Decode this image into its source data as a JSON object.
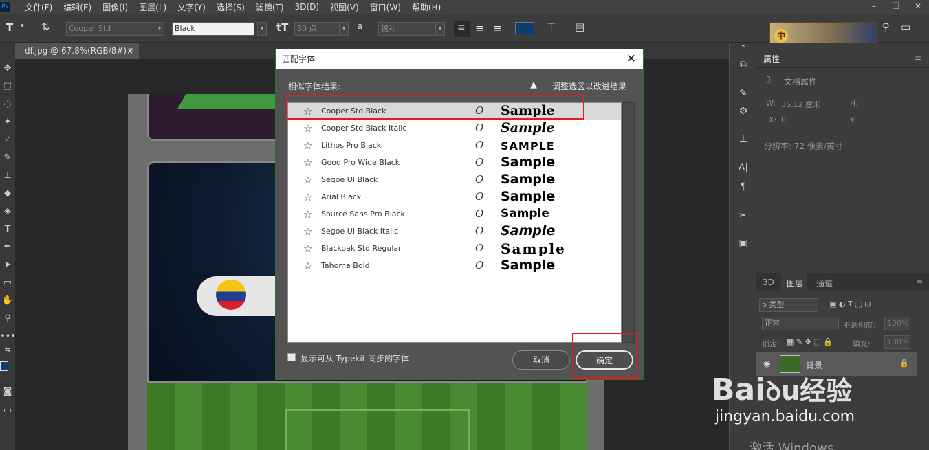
{
  "app": {
    "logo": "Ps"
  },
  "menubar": {
    "items": [
      "文件(F)",
      "编辑(E)",
      "图像(I)",
      "图层(L)",
      "文字(Y)",
      "选择(S)",
      "滤镜(T)",
      "3D(D)",
      "视图(V)",
      "窗口(W)",
      "帮助(H)"
    ]
  },
  "options": {
    "font_family": "Cooper Std",
    "font_style": "Black",
    "font_size": "30 点",
    "aa_label": "a",
    "antialias": "锐利"
  },
  "document": {
    "tab_title": "df.jpg @ 67.8%(RGB/8#) *",
    "tab_close": "×"
  },
  "ime": {
    "label": "中"
  },
  "properties": {
    "tab": "属性",
    "doc_props": "文档属性",
    "w_label": "W:",
    "w_value": "36.12 厘米",
    "h_label": "H:",
    "x_label": "X:",
    "x_value": "0",
    "y_label": "Y:",
    "resolution": "分辨率: 72 像素/英寸"
  },
  "layers": {
    "tabs": [
      "3D",
      "图层",
      "通道"
    ],
    "filter": "ρ 类型",
    "blend": "正常",
    "opacity_label": "不透明度:",
    "opacity": "100%",
    "lock_label": "锁定:",
    "fill_label": "填充:",
    "fill": "100%",
    "layer_name": "背景"
  },
  "dialog": {
    "title": "匹配字体",
    "close": "✕",
    "results_label": "相似字体结果:",
    "hint": "调整选区以改进结果",
    "fonts": [
      {
        "name": "Cooper Std Black",
        "type_glyph": "O",
        "sample": "Sample",
        "selected": true
      },
      {
        "name": "Cooper Std Black Italic",
        "type_glyph": "O",
        "sample": "Sample",
        "selected": false
      },
      {
        "name": "Lithos Pro Black",
        "type_glyph": "O",
        "sample": "SAMPLE",
        "selected": false
      },
      {
        "name": "Good Pro Wide Black",
        "type_glyph": "O",
        "sample": "Sample",
        "selected": false
      },
      {
        "name": "Segoe UI Black",
        "type_glyph": "O",
        "sample": "Sample",
        "selected": false
      },
      {
        "name": "Arial Black",
        "type_glyph": "O",
        "sample": "Sample",
        "selected": false
      },
      {
        "name": "Source Sans Pro Black",
        "type_glyph": "O",
        "sample": "Sample",
        "selected": false
      },
      {
        "name": "Segoe UI Black Italic",
        "type_glyph": "O",
        "sample": "Sample",
        "selected": false
      },
      {
        "name": "Blackoak Std Regular",
        "type_glyph": "O",
        "sample": "Sample",
        "selected": false
      },
      {
        "name": "Tahoma Bold",
        "type_glyph": "O",
        "sample": "Sample",
        "selected": false
      }
    ],
    "typekit_label": "显示可从 Typekit 同步的字体",
    "cancel": "取消",
    "ok": "确定"
  },
  "watermark": {
    "brand": "Bai",
    "brand2": "经验",
    "url": "jingyan.baidu.com",
    "activate": "激活 Windows"
  },
  "colors": {
    "highlight": "#e8181f",
    "foreground": "#0d3d6e",
    "background": "#5fb8a8"
  }
}
